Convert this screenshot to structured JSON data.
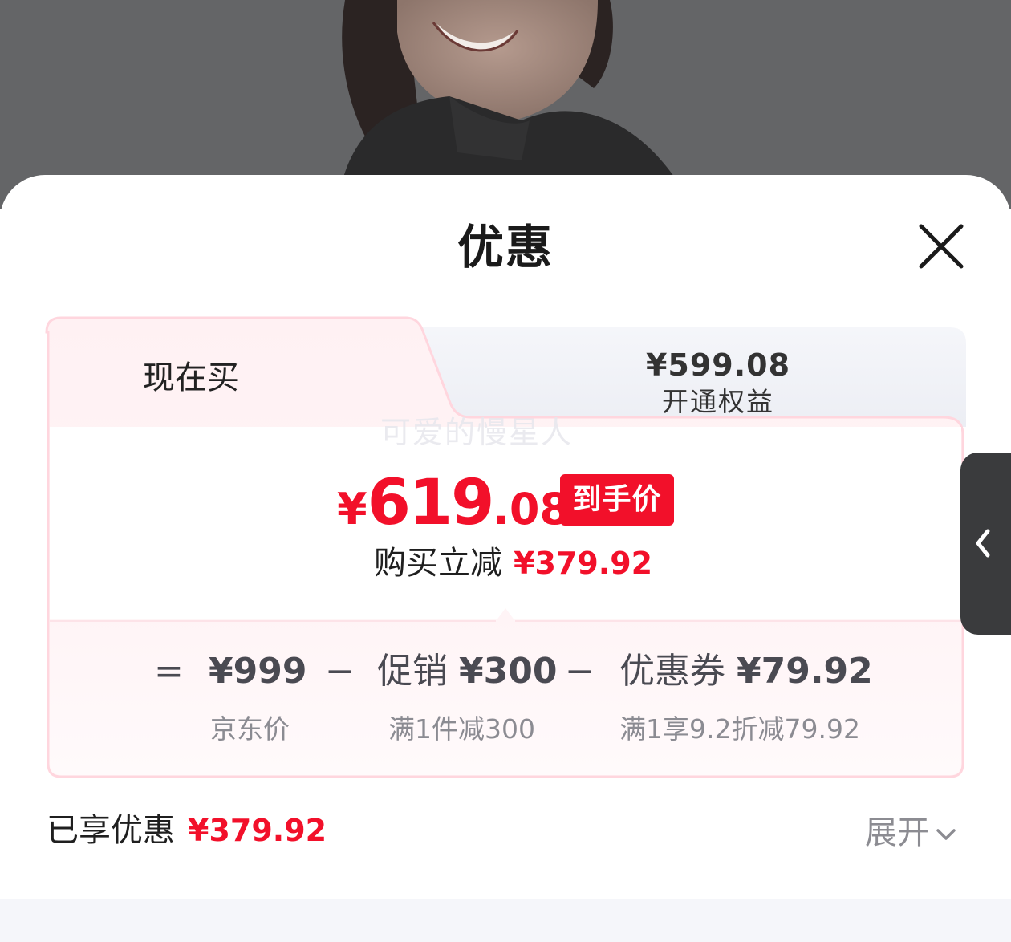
{
  "sheet": {
    "title": "优惠"
  },
  "tabs": {
    "now_label": "现在买",
    "member_price": "¥599.08",
    "member_label": "开通权益"
  },
  "watermark": "可爱的慢星人",
  "final": {
    "currency": "¥",
    "integer": "619",
    "decimal": ".08",
    "tag": "到手价",
    "saving_label": "购买立减",
    "saving_amount": "¥379.92"
  },
  "breakdown": {
    "equals": "=",
    "base_value": "¥999",
    "base_label": "京东价",
    "minus1": "−",
    "promo_name": "促销",
    "promo_value": "¥300",
    "promo_rule": "满1件减300",
    "minus2": "−",
    "coupon_name": "优惠券",
    "coupon_value": "¥79.92",
    "coupon_rule": "满1享9.2折减79.92"
  },
  "footer": {
    "enjoyed_label": "已享优惠",
    "enjoyed_amount": "¥379.92",
    "expand_label": "展开"
  },
  "colors": {
    "accent_red": "#f2102a",
    "card_border": "#ffd6de",
    "text_dark": "#1f1f1f",
    "text_muted": "#8b8b92"
  },
  "icons": {
    "close": "close-icon",
    "expand": "chevron-down-icon",
    "side": "chevron-left-icon"
  }
}
